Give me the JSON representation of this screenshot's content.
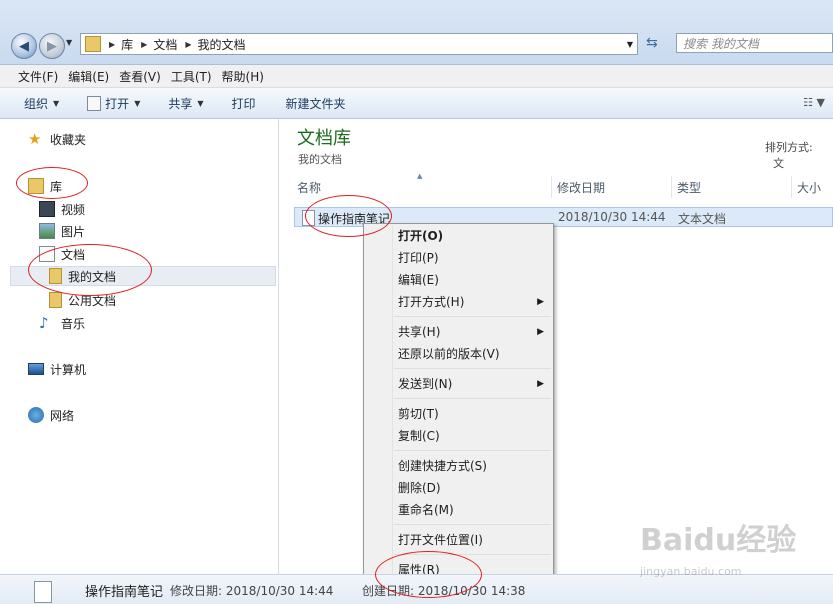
{
  "address": {
    "path": [
      "库",
      "文档",
      "我的文档"
    ]
  },
  "search": {
    "placeholder": "搜索 我的文档"
  },
  "menubar": [
    "文件(F)",
    "编辑(E)",
    "查看(V)",
    "工具(T)",
    "帮助(H)"
  ],
  "toolbar": {
    "organize": "组织",
    "open": "打开",
    "share": "共享",
    "print": "打印",
    "new_folder": "新建文件夹"
  },
  "nav": {
    "favorites": "收藏夹",
    "libraries": "库",
    "videos": "视频",
    "pictures": "图片",
    "documents": "文档",
    "my_documents": "我的文档",
    "public_documents": "公用文档",
    "music": "音乐",
    "computer": "计算机",
    "network": "网络"
  },
  "content": {
    "title": "文档库",
    "subtitle": "我的文档",
    "sort_label": "排列方式:",
    "sort_value": "文",
    "columns": [
      "名称",
      "修改日期",
      "类型",
      "大小"
    ],
    "file": {
      "name": "操作指南笔记",
      "date": "2018/10/30 14:44",
      "type": "文本文档"
    }
  },
  "context_menu": [
    {
      "label": "打开(O)",
      "bold": true
    },
    {
      "label": "打印(P)"
    },
    {
      "label": "编辑(E)"
    },
    {
      "label": "打开方式(H)",
      "submenu": true
    },
    {
      "label": "共享(H)",
      "submenu": true
    },
    {
      "label": "还原以前的版本(V)"
    },
    {
      "label": "发送到(N)",
      "submenu": true
    },
    {
      "label": "剪切(T)"
    },
    {
      "label": "复制(C)"
    },
    {
      "label": "创建快捷方式(S)"
    },
    {
      "label": "删除(D)"
    },
    {
      "label": "重命名(M)"
    },
    {
      "label": "打开文件位置(I)"
    },
    {
      "label": "属性(R)"
    }
  ],
  "status": {
    "name": "操作指南笔记",
    "modified": "修改日期: 2018/10/30 14:44",
    "created": "创建日期: 2018/10/30 14:38"
  },
  "watermark": {
    "brand": "Baidu经验",
    "url": "jingyan.baidu.com"
  },
  "colors": {
    "annotation": "#e02020",
    "library_title": "#1e6a1e"
  }
}
